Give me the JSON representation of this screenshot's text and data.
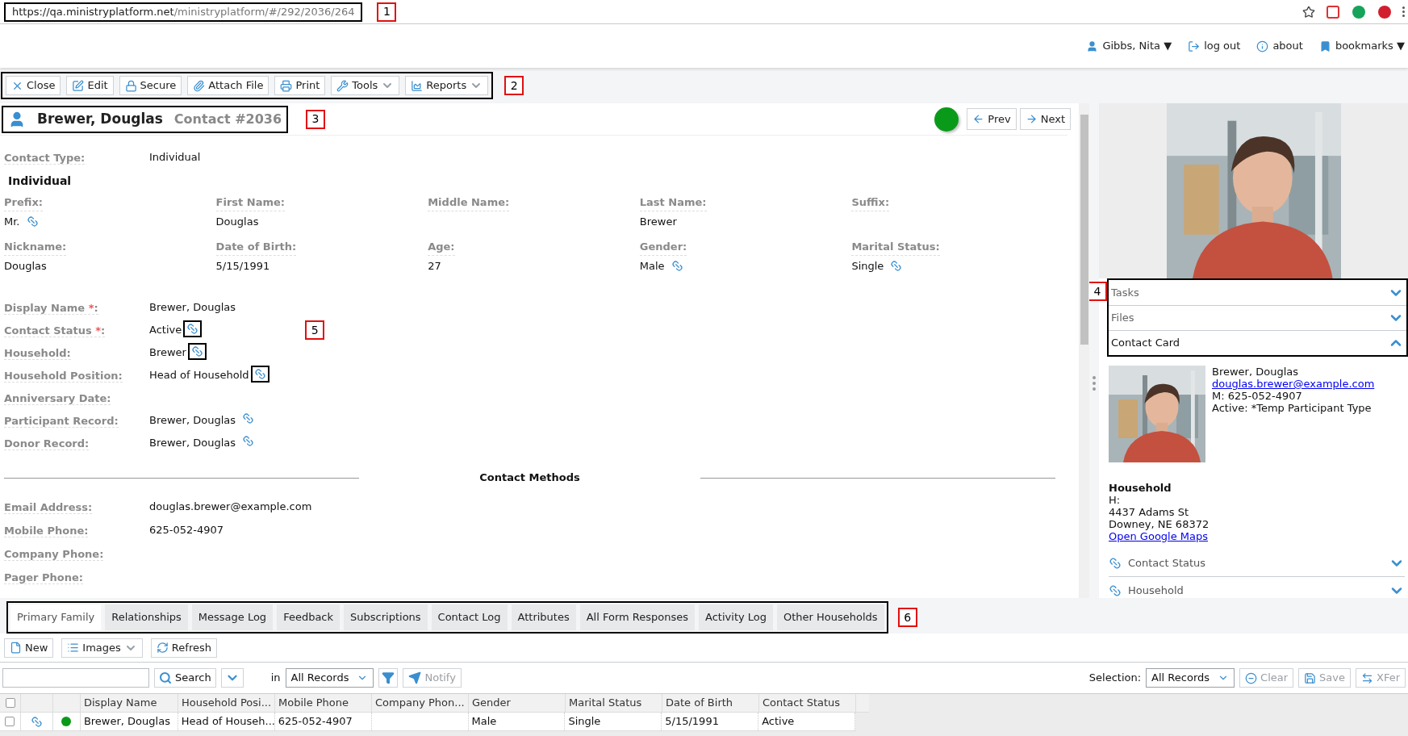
{
  "browser": {
    "url_host": "https://qa.ministryplatform.net",
    "url_path": "/ministryplatform/#/292/2036/264"
  },
  "user_menu": [
    {
      "kind": "user",
      "label": "Gibbs, Nita ▼"
    },
    {
      "kind": "logout",
      "label": "log out"
    },
    {
      "kind": "about",
      "label": "about"
    },
    {
      "kind": "bookmarks",
      "label": "bookmarks ▼"
    }
  ],
  "toolbar": [
    {
      "kind": "close",
      "label": "Close",
      "has_menu": false
    },
    {
      "kind": "edit",
      "label": "Edit",
      "has_menu": false
    },
    {
      "kind": "secure",
      "label": "Secure",
      "has_menu": false
    },
    {
      "kind": "attach",
      "label": "Attach File",
      "has_menu": false
    },
    {
      "kind": "print",
      "label": "Print",
      "has_menu": false
    },
    {
      "kind": "tools",
      "label": "Tools",
      "has_menu": true
    },
    {
      "kind": "reports",
      "label": "Reports",
      "has_menu": true
    }
  ],
  "record": {
    "name": "Brewer, Douglas",
    "number": "Contact #2036",
    "status": {
      "color": "#0a9a1a"
    }
  },
  "nav": [
    {
      "kind": "prev",
      "label": "Prev"
    },
    {
      "kind": "next",
      "label": "Next"
    }
  ],
  "contact_type": {
    "label": "Contact Type:",
    "value": "Individual"
  },
  "section_title": "Individual",
  "name_fields": [
    [
      {
        "label": "Prefix:",
        "value": "Mr.",
        "linked": true
      },
      {
        "label": "First Name:",
        "value": "Douglas",
        "linked": false
      },
      {
        "label": "Middle Name:",
        "linked": false
      },
      {
        "label": "Last Name:",
        "value": "Brewer",
        "linked": false
      },
      {
        "label": "Suffix:",
        "linked": false
      }
    ],
    [
      {
        "label": "Nickname:",
        "value": "Douglas",
        "linked": false
      },
      {
        "label": "Date of Birth:",
        "value": "5/15/1991",
        "linked": false
      },
      {
        "label": "Age:",
        "value": "27",
        "linked": false
      },
      {
        "label": "Gender:",
        "value": "Male",
        "linked": true
      },
      {
        "label": "Marital Status:",
        "value": "Single",
        "linked": true
      }
    ]
  ],
  "detail_fields": [
    {
      "label": "Display Name",
      "required_mark": "*",
      "label_suffix": ":",
      "value": "Brewer, Douglas",
      "linked": false
    },
    {
      "label": "Contact Status",
      "required_mark": "*",
      "label_suffix": ":",
      "value": "Active",
      "linked": true,
      "outlined": true
    },
    {
      "label": "Household:",
      "value": "Brewer",
      "linked": true,
      "outlined": true
    },
    {
      "label": "Household Position:",
      "value": "Head of Household",
      "linked": true,
      "outlined": true
    },
    {
      "label": "Anniversary Date:",
      "linked": false
    },
    {
      "label": "Participant Record:",
      "value": "Brewer, Douglas",
      "linked": true,
      "outlined": false
    },
    {
      "label": "Donor Record:",
      "value": "Brewer, Douglas",
      "linked": true,
      "outlined": false
    }
  ],
  "contact_methods": {
    "title": "Contact Methods",
    "fields": [
      {
        "label": "Email Address:",
        "value": "douglas.brewer@example.com"
      },
      {
        "label": "Mobile Phone:",
        "value": "625-052-4907"
      },
      {
        "label": "Company Phone:"
      },
      {
        "label": "Pager Phone:"
      }
    ]
  },
  "photo": {
    "kind": "picture"
  },
  "panels": [
    {
      "title": "Tasks",
      "expanded": false
    },
    {
      "title": "Files",
      "expanded": false
    },
    {
      "title": "Contact Card",
      "expanded": true
    }
  ],
  "contact_card": {
    "photo": {
      "kind": "picture"
    },
    "name": "Brewer, Douglas",
    "email": "douglas.brewer@example.com",
    "mobile": "M: 625-052-4907",
    "status": "Active: *Temp Participant Type",
    "household_title": "Household",
    "household_phone": "H:",
    "address_line1": "4437 Adams St",
    "address_line2": "Downey, NE 68372",
    "map_link": "Open Google Maps"
  },
  "subsections": [
    {
      "title": "Contact Status",
      "expanded": false
    },
    {
      "title": "Household",
      "expanded": false
    }
  ],
  "tabs": [
    {
      "label": "Primary Family",
      "selected": true
    },
    {
      "label": "Relationships",
      "selected": false
    },
    {
      "label": "Message Log",
      "selected": false
    },
    {
      "label": "Feedback",
      "selected": false
    },
    {
      "label": "Subscriptions",
      "selected": false
    },
    {
      "label": "Contact Log",
      "selected": false
    },
    {
      "label": "Attributes",
      "selected": false
    },
    {
      "label": "All Form Responses",
      "selected": false
    },
    {
      "label": "Activity Log",
      "selected": false
    },
    {
      "label": "Other Households",
      "selected": false
    }
  ],
  "list_toolbar": [
    {
      "kind": "new",
      "label": "New",
      "has_menu": false
    },
    {
      "kind": "images",
      "label": "Images",
      "has_menu": true
    },
    {
      "kind": "refresh",
      "label": "Refresh",
      "has_menu": false
    }
  ],
  "search": {
    "button": "Search",
    "in_label": "in",
    "scope": "All Records",
    "notify": {
      "label": "Notify",
      "disabled": true
    },
    "selection_label": "Selection:",
    "selection": "All Records",
    "actions": [
      {
        "kind": "clear",
        "label": "Clear",
        "disabled": true
      },
      {
        "kind": "save",
        "label": "Save",
        "disabled": true
      },
      {
        "kind": "transfer",
        "label": "XFer",
        "disabled": true
      }
    ]
  },
  "table": {
    "columns": [
      "Display Name",
      "Household Posi...",
      "Mobile Phone",
      "Company Phon...",
      "Gender",
      "Marital Status",
      "Date of Birth",
      "Contact Status"
    ],
    "select_all_checked": false,
    "rows": [
      {
        "checked": false,
        "linked": true,
        "color": "#0a9a1a",
        "cells": [
          "Brewer, Douglas",
          "Head of Househ...",
          "625-052-4907",
          "",
          "Male",
          "Single",
          "5/15/1991",
          "Active"
        ]
      }
    ]
  },
  "annotations": [
    "1",
    "2",
    "3",
    "4",
    "5",
    "6"
  ]
}
